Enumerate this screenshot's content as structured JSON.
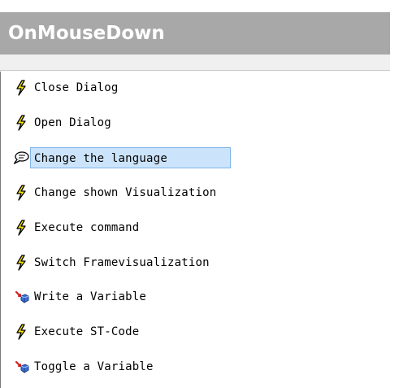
{
  "header": {
    "title": "OnMouseDown"
  },
  "actions": {
    "items": [
      {
        "label": "Close Dialog",
        "icon": "lightning-icon",
        "selected": false
      },
      {
        "label": "Open Dialog",
        "icon": "lightning-icon",
        "selected": false
      },
      {
        "label": "Change the language",
        "icon": "speech-bubble-icon",
        "selected": true
      },
      {
        "label": "Change shown Visualization",
        "icon": "lightning-icon",
        "selected": false
      },
      {
        "label": "Execute command",
        "icon": "lightning-icon",
        "selected": false
      },
      {
        "label": "Switch Framevisualization",
        "icon": "lightning-icon",
        "selected": false
      },
      {
        "label": "Write a Variable",
        "icon": "variable-write-icon",
        "selected": false
      },
      {
        "label": "Execute ST-Code",
        "icon": "lightning-icon",
        "selected": false
      },
      {
        "label": "Toggle a Variable",
        "icon": "variable-toggle-icon",
        "selected": false
      }
    ]
  },
  "colors": {
    "header_bg": "#a8a8a8",
    "selection_bg": "#cce4fb",
    "selection_border": "#7fb4e8",
    "lightning_fill": "#f5e400"
  }
}
